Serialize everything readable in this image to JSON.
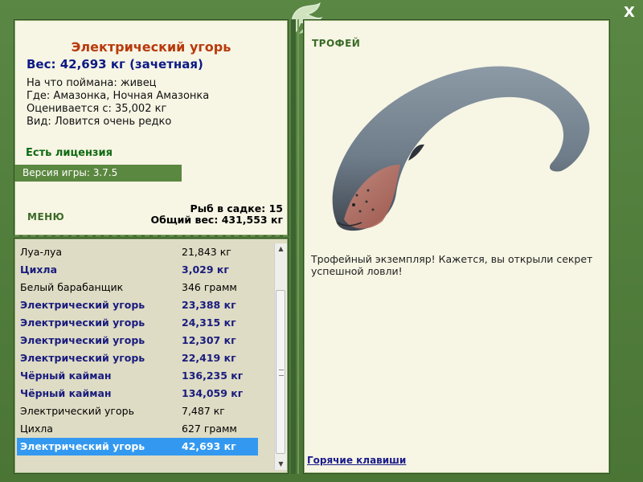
{
  "fish": {
    "name": "Электрический угорь",
    "weight_line": "Вес: 42,693 кг (зачетная)",
    "bait_line": "На что поймана: живец",
    "where_line": "Где: Амазонка, Ночная Амазонка",
    "value_line": "Оценивается с: 35,002 кг",
    "kind_line": "Вид: Ловится очень редко"
  },
  "license": "Есть лицензия",
  "version": "Версия игры: 3.7.5",
  "menu_label": "МЕНЮ",
  "stats": {
    "fish_count": "Рыб в садке: 15",
    "total_weight": "Общий вес: 431,553 кг"
  },
  "catch_list": [
    {
      "name": "Луа-луа",
      "weight": "21,843 кг",
      "bold": false
    },
    {
      "name": "Цихла",
      "weight": "3,029 кг",
      "bold": true
    },
    {
      "name": "Белый барабанщик",
      "weight": "346 грамм",
      "bold": false
    },
    {
      "name": "Электрический угорь",
      "weight": "23,388 кг",
      "bold": true
    },
    {
      "name": "Электрический угорь",
      "weight": "24,315 кг",
      "bold": true
    },
    {
      "name": "Электрический угорь",
      "weight": "12,307 кг",
      "bold": true
    },
    {
      "name": "Электрический угорь",
      "weight": "22,419 кг",
      "bold": true
    },
    {
      "name": "Чёрный кайман",
      "weight": "136,235 кг",
      "bold": true
    },
    {
      "name": "Чёрный кайман",
      "weight": "134,059 кг",
      "bold": true
    },
    {
      "name": "Электрический угорь",
      "weight": "7,487 кг",
      "bold": false
    },
    {
      "name": "Цихла",
      "weight": "627 грамм",
      "bold": false
    },
    {
      "name": "Электрический угорь",
      "weight": "42,693 кг",
      "bold": true,
      "selected": true
    }
  ],
  "trophy": {
    "label": "ТРОФЕЙ",
    "text": "Трофейный экземпляр! Кажется, вы открыли секрет успешной ловли!"
  },
  "hotkeys": "Горячие клавиши",
  "close_label": "X",
  "icons": {
    "close": "close-icon",
    "logo": "fish-logo-icon",
    "scroll_up": "arrow-up-icon",
    "scroll_down": "arrow-down-icon"
  },
  "colors": {
    "frame": "#4f7a3c",
    "panel": "#f7f5e4",
    "title": "#b83a0c",
    "weight": "#0c1a86",
    "license": "#0f6a12",
    "selection": "#3399f0"
  }
}
